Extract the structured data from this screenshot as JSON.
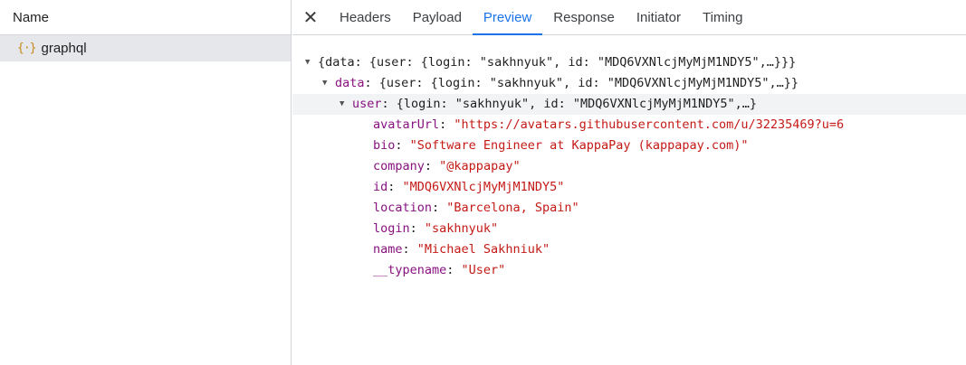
{
  "request_list": {
    "column_header": "Name",
    "items": [
      {
        "icon": "graphql-icon",
        "name": "graphql"
      }
    ]
  },
  "tabs": {
    "close_symbol": "✕",
    "items": [
      "Headers",
      "Payload",
      "Preview",
      "Response",
      "Initiator",
      "Timing"
    ],
    "active": "Preview"
  },
  "preview": {
    "root_summary": "{data: {user: {login: \"sakhnyuk\", id: \"MDQ6VXNlcjMyMjM1NDY5\",…}}}",
    "data_key": "data",
    "data_summary": "{user: {login: \"sakhnyuk\", id: \"MDQ6VXNlcjMyMjM1NDY5\",…}}",
    "user_key": "user",
    "user_summary": "{login: \"sakhnyuk\", id: \"MDQ6VXNlcjMyMjM1NDY5\",…}",
    "fields": [
      {
        "key": "avatarUrl",
        "value": "\"https://avatars.githubusercontent.com/u/32235469?u=6"
      },
      {
        "key": "bio",
        "value": "\"Software Engineer at KappaPay (kappapay.com)\""
      },
      {
        "key": "company",
        "value": "\"@kappapay\""
      },
      {
        "key": "id",
        "value": "\"MDQ6VXNlcjMyMjM1NDY5\""
      },
      {
        "key": "location",
        "value": "\"Barcelona, Spain\""
      },
      {
        "key": "login",
        "value": "\"sakhnyuk\""
      },
      {
        "key": "name",
        "value": "\"Michael Sakhniuk\""
      },
      {
        "key": "__typename",
        "value": "\"User\""
      }
    ]
  }
}
